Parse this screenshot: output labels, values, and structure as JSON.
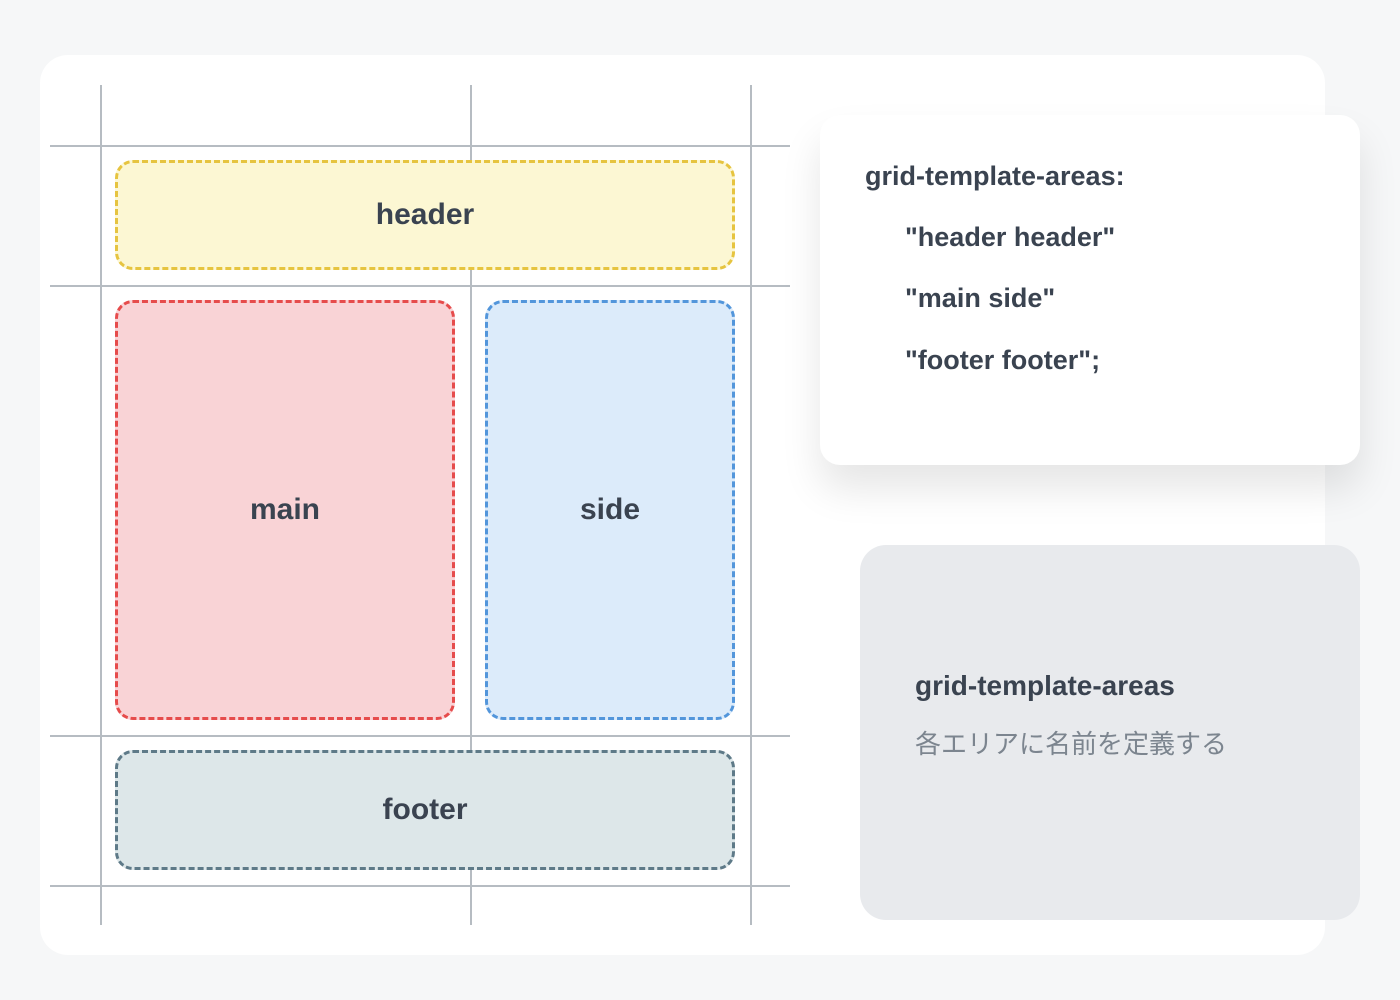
{
  "diagram": {
    "areas": {
      "header": "header",
      "main": "main",
      "side": "side",
      "footer": "footer"
    }
  },
  "code": {
    "property": "grid-template-areas:",
    "row1": "\"header header\"",
    "row2": "\"main side\"",
    "row3": "\"footer footer\";"
  },
  "description": {
    "title": "grid-template-areas",
    "text": "各エリアに名前を定義する"
  }
}
